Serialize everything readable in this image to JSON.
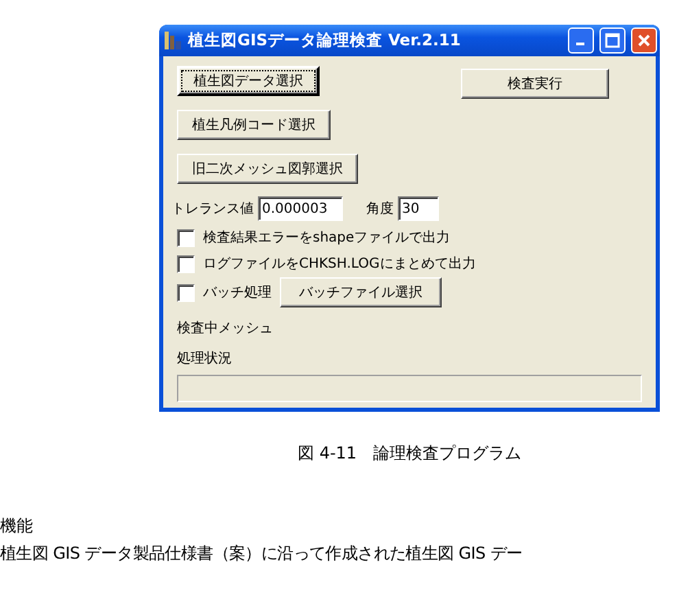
{
  "window": {
    "title": "植生図GISデータ論理検査 Ver.2.11"
  },
  "select_buttons": [
    {
      "label": "植生図データ選択",
      "focused": true
    },
    {
      "label": "植生凡例コード選択",
      "focused": false
    },
    {
      "label": "旧二次メッシュ図郭選択",
      "focused": false
    }
  ],
  "run_button": {
    "label": "検査実行"
  },
  "tolerance": {
    "label": "トレランス値",
    "value": "0.000003"
  },
  "angle": {
    "label": "角度",
    "value": "30"
  },
  "options": [
    {
      "label": "検査結果エラーをshapeファイルで出力",
      "checked": false
    },
    {
      "label": "ログファイルをCHKSH.LOGにまとめて出力",
      "checked": false
    }
  ],
  "batch": {
    "label": "バッチ処理",
    "checked": false,
    "button": "バッチファイル選択"
  },
  "status_labels": [
    "検査中メッシュ",
    "処理状況"
  ],
  "progress": {
    "level": 0
  },
  "caption": "図 4-11　論理検査プログラム",
  "section_heading": "機能",
  "body_text": "植生図 GIS データ製品仕様書（案）に沿って作成された植生図 GIS デー"
}
